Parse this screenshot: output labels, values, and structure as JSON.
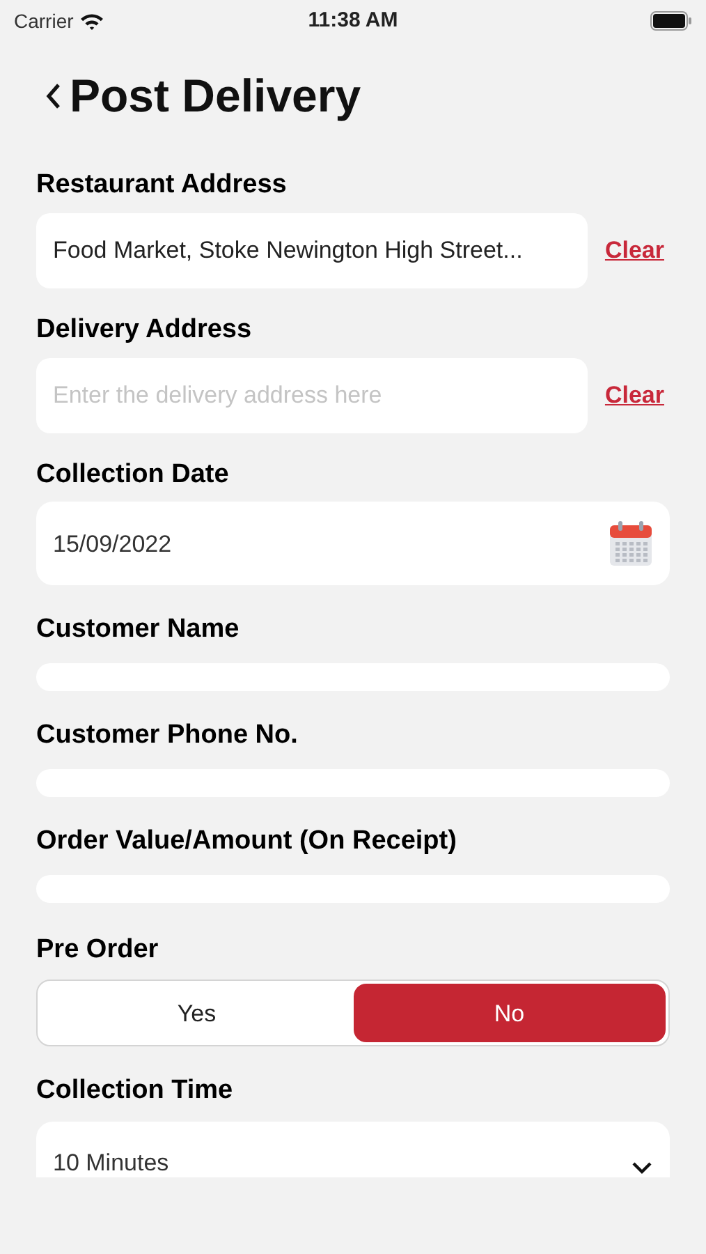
{
  "status_bar": {
    "carrier": "Carrier",
    "time": "11:38 AM"
  },
  "title": "Post Delivery",
  "fields": [
    {
      "kind": "address",
      "label": "Restaurant Address",
      "value": "Food Market, Stoke Newington High Street...",
      "action": "Clear"
    },
    {
      "kind": "address",
      "label": "Delivery Address",
      "placeholder": "Enter the delivery address here",
      "action": "Clear"
    },
    {
      "kind": "date",
      "label": "Collection Date",
      "value": "15/09/2022"
    },
    {
      "kind": "collapsed",
      "label": "Customer Name"
    },
    {
      "kind": "collapsed",
      "label": "Customer Phone No."
    },
    {
      "kind": "collapsed",
      "label": "Order Value/Amount (On Receipt)"
    },
    {
      "kind": "segmented",
      "label": "Pre Order",
      "options": [
        {
          "label": "Yes",
          "selected": false
        },
        {
          "label": "No",
          "selected": true
        }
      ]
    },
    {
      "kind": "dropdown",
      "label": "Collection Time",
      "value": "10 Minutes"
    }
  ]
}
